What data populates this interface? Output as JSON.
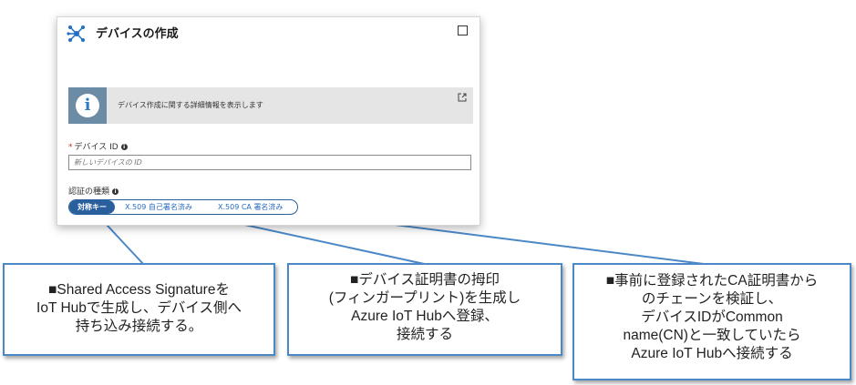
{
  "panel": {
    "title": "デバイスの作成",
    "icons": {
      "app": "iot-hub-icon",
      "maximize": "maximize-icon",
      "info": "info-icon",
      "external": "external-link-icon"
    },
    "info_banner": {
      "text": "デバイス作成に関する詳細情報を表示します"
    },
    "device_id": {
      "required_mark": "*",
      "label": "デバイス ID",
      "placeholder": "新しいデバイスの ID",
      "value": ""
    },
    "auth_type": {
      "label": "認証の種類",
      "options": [
        "対称キー",
        "X.509 自己署名済み",
        "X.509 CA 署名済み"
      ],
      "selected": "対称キー"
    }
  },
  "callouts": [
    {
      "lines": [
        "■Shared Access Signatureを",
        "IoT Hubで生成し、デバイス側へ",
        "持ち込み接続する。"
      ]
    },
    {
      "lines": [
        "■デバイス証明書の拇印",
        "(フィンガープリント)を生成し",
        "Azure IoT Hubへ登録、",
        "接続する"
      ]
    },
    {
      "lines": [
        "■事前に登録されたCA証明書から",
        "のチェーンを検証し、",
        "デバイスIDがCommon",
        "name(CN)と一致していたら",
        "Azure IoT Hubへ接続する"
      ]
    }
  ],
  "colors": {
    "accent": "#2a5f9e",
    "callout_border": "#4b88c8",
    "required": "#c8322a"
  }
}
